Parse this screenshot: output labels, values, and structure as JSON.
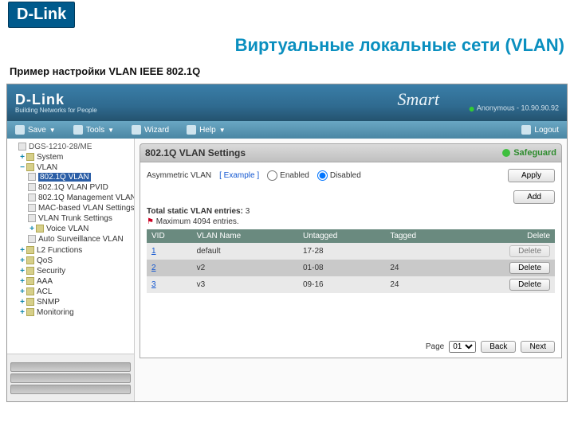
{
  "outer": {
    "brand": "D-Link",
    "title": "Виртуальные локальные сети (VLAN)",
    "subtitle": "Пример настройки VLAN IEEE 802.1Q"
  },
  "app": {
    "brand": "D-Link",
    "brand_tagline": "Building Networks for People",
    "smart_label": "Smart",
    "status_user": "Anonymous - 10.90.90.92"
  },
  "menubar": {
    "save": "Save",
    "tools": "Tools",
    "wizard": "Wizard",
    "help": "Help",
    "logout": "Logout"
  },
  "tree": {
    "root": "DGS-1210-28/ME",
    "system": "System",
    "vlan": "VLAN",
    "vlan_children": [
      "802.1Q VLAN",
      "802.1Q VLAN PVID",
      "802.1Q Management VLAN",
      "MAC-based VLAN Settings",
      "VLAN Trunk Settings",
      "Voice VLAN",
      "Auto Surveillance VLAN"
    ],
    "others": [
      "L2 Functions",
      "QoS",
      "Security",
      "AAA",
      "ACL",
      "SNMP",
      "Monitoring"
    ]
  },
  "panel": {
    "title": "802.1Q VLAN Settings",
    "safeguard": "Safeguard",
    "asym_label": "Asymmetric VLAN",
    "example_link": "[ Example ]",
    "enabled_label": "Enabled",
    "disabled_label": "Disabled",
    "apply_btn": "Apply",
    "add_btn": "Add",
    "total_label": "Total static VLAN entries:",
    "total_value": "3",
    "max_label": "Maximum 4094 entries.",
    "cols": {
      "vid": "VID",
      "name": "VLAN Name",
      "untagged": "Untagged",
      "tagged": "Tagged",
      "delete": "Delete"
    },
    "rows": [
      {
        "vid": "1",
        "name": "default",
        "untagged": "17-28",
        "tagged": "",
        "delete": "Delete"
      },
      {
        "vid": "2",
        "name": "v2",
        "untagged": "01-08",
        "tagged": "24",
        "delete": "Delete"
      },
      {
        "vid": "3",
        "name": "v3",
        "untagged": "09-16",
        "tagged": "24",
        "delete": "Delete"
      }
    ],
    "pager": {
      "label": "Page",
      "current": "01",
      "back": "Back",
      "next": "Next"
    }
  }
}
